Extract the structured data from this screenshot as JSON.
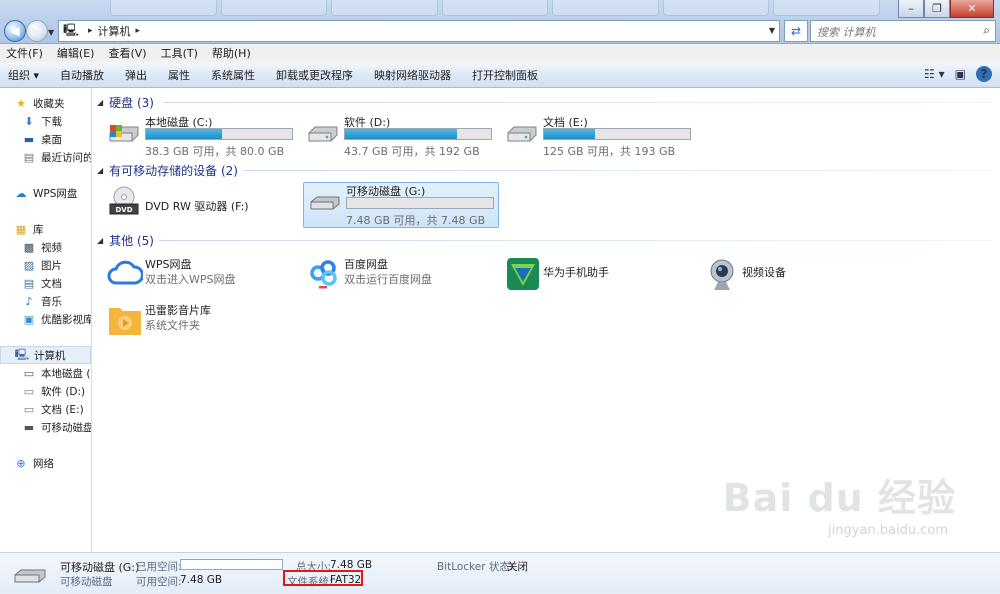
{
  "address": {
    "segments": [
      "计算机"
    ]
  },
  "search": {
    "placeholder": "搜索 计算机"
  },
  "menu": [
    "文件(F)",
    "编辑(E)",
    "查看(V)",
    "工具(T)",
    "帮助(H)"
  ],
  "commands": [
    "组织 ▾",
    "自动播放",
    "弹出",
    "属性",
    "系统属性",
    "卸载或更改程序",
    "映射网络驱动器",
    "打开控制面板"
  ],
  "sidebar": {
    "favorites": {
      "label": "收藏夹",
      "items": [
        "下载",
        "桌面",
        "最近访问的位"
      ]
    },
    "wps": "WPS网盘",
    "library": {
      "label": "库",
      "items": [
        "视频",
        "图片",
        "文档",
        "音乐",
        "优酷影视库"
      ]
    },
    "computer": {
      "label": "计算机",
      "items": [
        "本地磁盘 (C:",
        "软件 (D:)",
        "文档 (E:)",
        "可移动磁盘 ("
      ]
    },
    "network": "网络"
  },
  "groups": {
    "hdd": "硬盘 (3)",
    "removable": "有可移动存储的设备 (2)",
    "other": "其他 (5)"
  },
  "drives": [
    {
      "name": "本地磁盘 (C:)",
      "info": "38.3 GB 可用，共 80.0 GB",
      "used_fraction": 0.52
    },
    {
      "name": "软件 (D:)",
      "info": "43.7 GB 可用，共 192 GB",
      "used_fraction": 0.77
    },
    {
      "name": "文档 (E:)",
      "info": "125 GB 可用，共 193 GB",
      "used_fraction": 0.35
    }
  ],
  "removable": [
    {
      "name": "DVD RW 驱动器 (F:)",
      "info": ""
    },
    {
      "name": "可移动磁盘 (G:)",
      "info": "7.48 GB 可用，共 7.48 GB",
      "used_fraction": 0.0
    }
  ],
  "others": [
    {
      "name": "WPS网盘",
      "desc": "双击进入WPS网盘"
    },
    {
      "name": "百度网盘",
      "desc": "双击运行百度网盘"
    },
    {
      "name": "华为手机助手",
      "desc": ""
    },
    {
      "name": "视频设备",
      "desc": ""
    },
    {
      "name": "迅雷影音片库",
      "desc": "系统文件夹"
    }
  ],
  "details": {
    "name": "可移动磁盘 (G:)",
    "type": "可移动磁盘",
    "used_label": "已用空间:",
    "free_label": "可用空间:",
    "free_value": "7.48 GB",
    "total_label": "总大小:",
    "total_value": "7.48 GB",
    "fs_label": "文件系统:",
    "fs_value": "FAT32",
    "bitlocker_label": "BitLocker 状态:",
    "bitlocker_value": "关闭"
  },
  "watermark": {
    "logo": "Bai du 经验",
    "url": "jingyan.baidu.com"
  }
}
